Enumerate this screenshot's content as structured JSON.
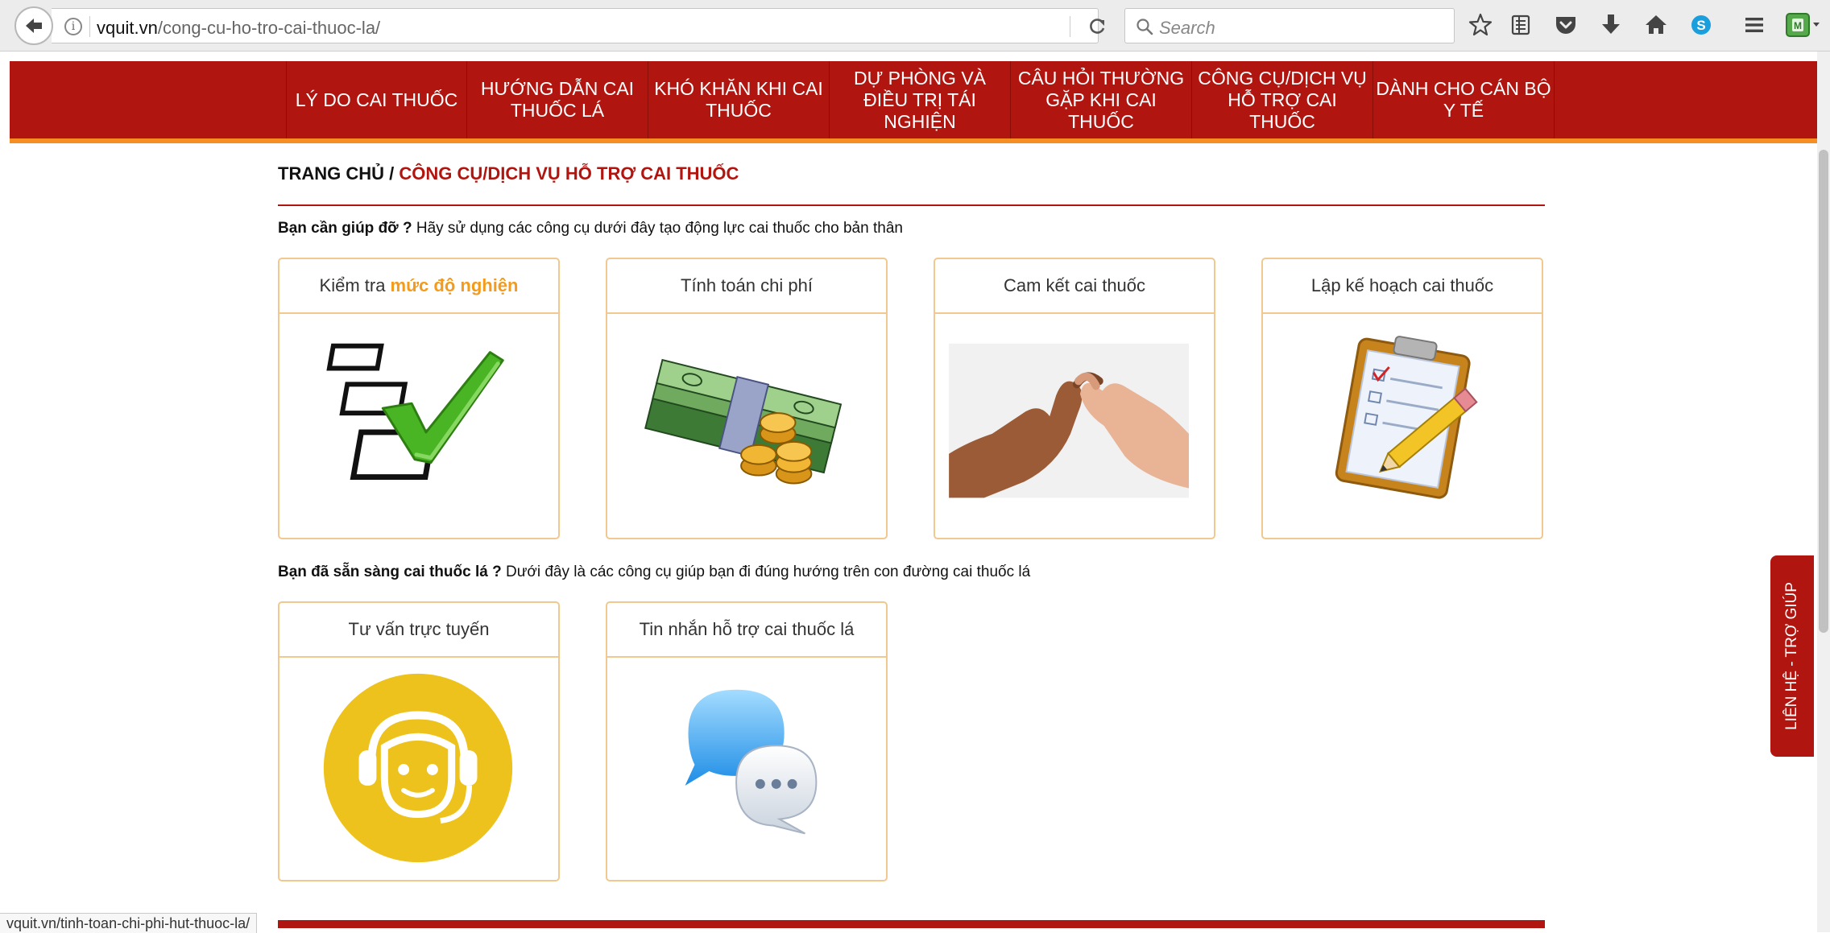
{
  "browser": {
    "url_domain": "vquit.vn",
    "url_path": "/cong-cu-ho-tro-cai-thuoc-la/",
    "search_placeholder": "Search",
    "status_url": "vquit.vn/tinh-toan-chi-phi-hut-thuoc-la/",
    "toolbar_icons": [
      "star-icon",
      "reading-list-icon",
      "pocket-icon",
      "download-icon",
      "home-icon",
      "skype-icon",
      "menu-icon",
      "extension-icon"
    ]
  },
  "nav": {
    "items": [
      {
        "label": "LÝ DO CAI THUỐC"
      },
      {
        "label": "HƯỚNG DẪN CAI THUỐC LÁ"
      },
      {
        "label": "KHÓ KHĂN KHI CAI THUỐC"
      },
      {
        "label": "DỰ PHÒNG VÀ ĐIỀU TRỊ TÁI NGHIỆN"
      },
      {
        "label": "CÂU HỎI THƯỜNG GẶP KHI CAI THUỐC"
      },
      {
        "label": "CÔNG CỤ/DỊCH VỤ HỖ TRỢ CAI THUỐC"
      },
      {
        "label": "DÀNH CHO CÁN BỘ Y TẾ"
      }
    ]
  },
  "breadcrumb": {
    "home": "TRANG CHỦ",
    "separator": " / ",
    "current": "CÔNG CỤ/DỊCH VỤ HỖ TRỢ CAI THUỐC"
  },
  "section1": {
    "intro_bold": "Bạn cần giúp đỡ ?",
    "intro_text": " Hãy sử dụng các công cụ dưới đây tạo động lực cai thuốc cho bản thân",
    "cards": [
      {
        "title_prefix": "Kiểm tra ",
        "title_highlight": "mức độ nghiện",
        "image": "checklist-icon"
      },
      {
        "title": "Tính toán chi phí",
        "image": "money-icon"
      },
      {
        "title": "Cam kết cai thuốc",
        "image": "pinky-promise-image"
      },
      {
        "title": "Lập kế hoạch cai thuốc",
        "image": "clipboard-icon"
      }
    ]
  },
  "section2": {
    "intro_bold": "Bạn đã sẵn sàng cai thuốc lá ?",
    "intro_text": " Dưới đây là các công cụ giúp bạn đi đúng hướng trên con đường cai thuốc lá",
    "cards": [
      {
        "title": "Tư vấn trực tuyến",
        "image": "headset-support-icon"
      },
      {
        "title": "Tin nhắn hỗ trợ cai thuốc lá",
        "image": "chat-bubbles-icon"
      }
    ]
  },
  "side_tab": {
    "label": "LIÊN HỆ - TRỢ GIÚP"
  },
  "colors": {
    "brand_red": "#b1150f",
    "accent_orange": "#f58f23",
    "card_border": "#f0c890",
    "highlight": "#f39b1c"
  }
}
